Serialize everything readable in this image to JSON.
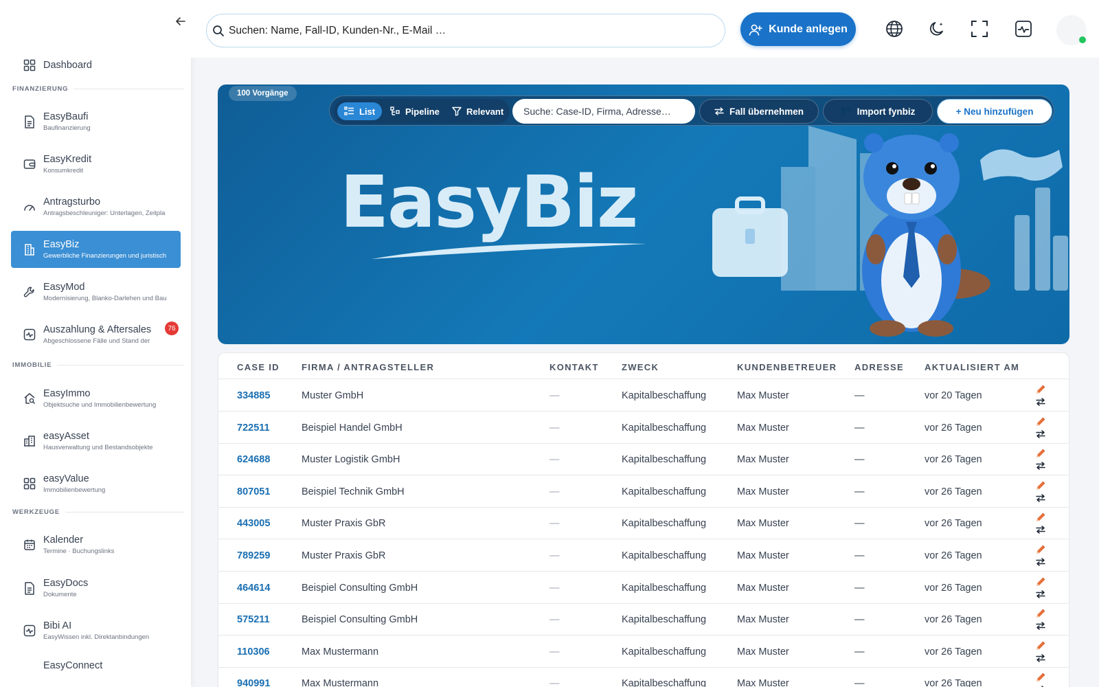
{
  "sidebar": {
    "collapse_icon": "arrow-left-icon",
    "items": [
      {
        "label": "Dashboard",
        "sub": "",
        "icon": "grid-icon"
      },
      {
        "label": "EasyBaufi",
        "sub": "Baufinanzierung",
        "icon": "document-icon"
      },
      {
        "label": "EasyKredit",
        "sub": "Konsumkredit",
        "icon": "wallet-icon"
      },
      {
        "label": "Antragsturbo",
        "sub": "Antragsbeschleuniger: Unterlagen, Zeitpla",
        "icon": "speedometer-icon"
      },
      {
        "label": "EasyBiz",
        "sub": "Gewerbliche Finanzierungen und juristisch",
        "icon": "building-icon"
      },
      {
        "label": "EasyMod",
        "sub": "Modernisierung, Blanko-Darlehen und Bau",
        "icon": "wrench-icon"
      },
      {
        "label": "Auszahlung & Aftersales",
        "sub": "Abgeschlossene Fälle und Stand der",
        "icon": "activity-icon",
        "badge": "76"
      },
      {
        "label": "EasyImmo",
        "sub": "Objektsuche und Immobilienbewertung",
        "icon": "home-search-icon"
      },
      {
        "label": "easyAsset",
        "sub": "Hausverwaltung und Bestandsobjekte",
        "icon": "buildings-icon"
      },
      {
        "label": "easyValue",
        "sub": "Immobilienbewertung",
        "icon": "grid-icon"
      },
      {
        "label": "Kalender",
        "sub": "Termine · Buchungslinks",
        "icon": "calendar-icon"
      },
      {
        "label": "EasyDocs",
        "sub": "Dokumente",
        "icon": "document-icon"
      },
      {
        "label": "Bibi AI",
        "sub": "EasyWissen inkl. Direktanbindungen",
        "icon": "activity-icon"
      },
      {
        "label": "EasyConnect",
        "sub": "",
        "icon": "link-icon"
      }
    ],
    "sections": {
      "finanzierung": "FINANZIERUNG",
      "immobilie": "IMMOBILIE",
      "werkzeuge": "WERKZEUGE"
    }
  },
  "topbar": {
    "search_placeholder": "Suchen: Name, Fall-ID, Kunden-Nr., E-Mail …",
    "kunde_button": "Kunde anlegen",
    "icons": [
      "globe-icon",
      "moon-icon",
      "fullscreen-icon",
      "pulse-icon"
    ]
  },
  "hero": {
    "count_badge": "100 Vorgänge",
    "logo": "EasyBiz",
    "views": [
      "List",
      "Pipeline",
      "Relevant"
    ],
    "active_view": "List",
    "search_placeholder": "Suche: Case-ID, Firma, Adresse…",
    "btn_take": "Fall übernehmen",
    "btn_import": "Import fynbiz",
    "btn_new": "+ Neu hinzufügen",
    "colors": {
      "accent": "#1a73c9",
      "banner": "#1479b8"
    }
  },
  "table": {
    "columns": [
      "CASE ID",
      "FIRMA / ANTRAGSTELLER",
      "KONTAKT",
      "ZWECK",
      "KUNDENBETREUER",
      "ADRESSE",
      "AKTUALISIERT AM"
    ],
    "rows": [
      {
        "id": "334885",
        "firma": "Muster GmbH",
        "kontakt": "—",
        "zweck": "Kapitalbeschaffung",
        "betreuer": "Max Muster",
        "adresse": "—",
        "aktualisiert": "vor 20 Tagen"
      },
      {
        "id": "722511",
        "firma": "Beispiel Handel GmbH",
        "kontakt": "—",
        "zweck": "Kapitalbeschaffung",
        "betreuer": "Max Muster",
        "adresse": "—",
        "aktualisiert": "vor 26 Tagen"
      },
      {
        "id": "624688",
        "firma": "Muster Logistik GmbH",
        "kontakt": "—",
        "zweck": "Kapitalbeschaffung",
        "betreuer": "Max Muster",
        "adresse": "—",
        "aktualisiert": "vor 26 Tagen"
      },
      {
        "id": "807051",
        "firma": "Beispiel Technik GmbH",
        "kontakt": "—",
        "zweck": "Kapitalbeschaffung",
        "betreuer": "Max Muster",
        "adresse": "—",
        "aktualisiert": "vor 26 Tagen"
      },
      {
        "id": "443005",
        "firma": "Muster Praxis GbR",
        "kontakt": "—",
        "zweck": "Kapitalbeschaffung",
        "betreuer": "Max Muster",
        "adresse": "—",
        "aktualisiert": "vor 26 Tagen"
      },
      {
        "id": "789259",
        "firma": "Muster Praxis GbR",
        "kontakt": "—",
        "zweck": "Kapitalbeschaffung",
        "betreuer": "Max Muster",
        "adresse": "—",
        "aktualisiert": "vor 26 Tagen"
      },
      {
        "id": "464614",
        "firma": "Beispiel Consulting GmbH",
        "kontakt": "—",
        "zweck": "Kapitalbeschaffung",
        "betreuer": "Max Muster",
        "adresse": "—",
        "aktualisiert": "vor 26 Tagen"
      },
      {
        "id": "575211",
        "firma": "Beispiel Consulting GmbH",
        "kontakt": "—",
        "zweck": "Kapitalbeschaffung",
        "betreuer": "Max Muster",
        "adresse": "—",
        "aktualisiert": "vor 26 Tagen"
      },
      {
        "id": "110306",
        "firma": "Max Mustermann",
        "kontakt": "—",
        "zweck": "Kapitalbeschaffung",
        "betreuer": "Max Muster",
        "adresse": "—",
        "aktualisiert": "vor 26 Tagen"
      },
      {
        "id": "940991",
        "firma": "Max Mustermann",
        "kontakt": "—",
        "zweck": "Kapitalbeschaffung",
        "betreuer": "Max Muster",
        "adresse": "—",
        "aktualisiert": "vor 26 Tagen"
      }
    ]
  }
}
